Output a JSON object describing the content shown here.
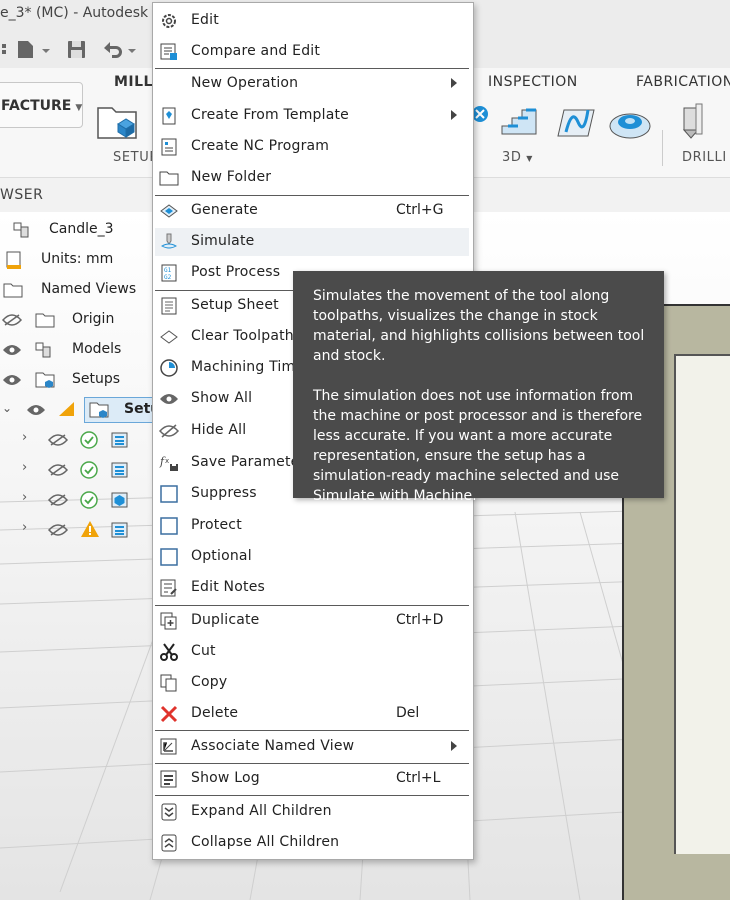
{
  "window": {
    "title": "e_3* (MC) - Autodesk Fu"
  },
  "ribbon": {
    "workspace_label": "FACTURE",
    "tabs": [
      "MILL",
      "INSPECTION",
      "FABRICATION"
    ],
    "groups": {
      "setup": "SETUP",
      "threed": "3D",
      "drilling": "DRILLI"
    }
  },
  "browser": {
    "header": "WSER",
    "items": [
      {
        "label": "Candle_3"
      },
      {
        "label": "Units: mm"
      },
      {
        "label": "Named Views"
      },
      {
        "label": "Origin"
      },
      {
        "label": "Models"
      },
      {
        "label": "Setups"
      },
      {
        "label": "Setu"
      }
    ]
  },
  "context_menu": {
    "items": {
      "edit": "Edit",
      "compare_edit": "Compare and Edit",
      "new_operation": "New Operation",
      "create_template": "Create From Template",
      "create_nc": "Create NC Program",
      "new_folder": "New Folder",
      "generate": "Generate",
      "simulate": "Simulate",
      "post_process": "Post Process",
      "setup_sheet": "Setup Sheet",
      "clear_toolpath": "Clear Toolpath",
      "machining_time": "Machining Tim",
      "show_all": "Show All",
      "hide_all": "Hide All",
      "save_parameters": "Save Paramete",
      "suppress": "Suppress",
      "protect": "Protect",
      "optional": "Optional",
      "edit_notes": "Edit Notes",
      "duplicate": "Duplicate",
      "cut": "Cut",
      "copy": "Copy",
      "delete": "Delete",
      "associate_view": "Associate Named View",
      "show_log": "Show Log",
      "expand_all": "Expand All Children",
      "collapse_all": "Collapse All Children"
    },
    "shortcuts": {
      "generate": "Ctrl+G",
      "duplicate": "Ctrl+D",
      "delete": "Del",
      "show_log": "Ctrl+L"
    }
  },
  "tooltip": {
    "para1": "Simulates the movement of the tool along toolpaths, visualizes the change in stock material, and highlights collisions between tool and stock.",
    "para2": "The simulation does not use information from the machine or post processor and is therefore less accurate. If you want a more accurate representation, ensure the setup has a simulation-ready machine selected and use Simulate with Machine."
  },
  "colors": {
    "accent": "#0696d7",
    "menu_highlight": "#eef1f4",
    "tooltip_bg": "#4b4b4b",
    "delete_red": "#e0332c",
    "warning": "#f0a30a",
    "check_green": "#4aa84a"
  }
}
